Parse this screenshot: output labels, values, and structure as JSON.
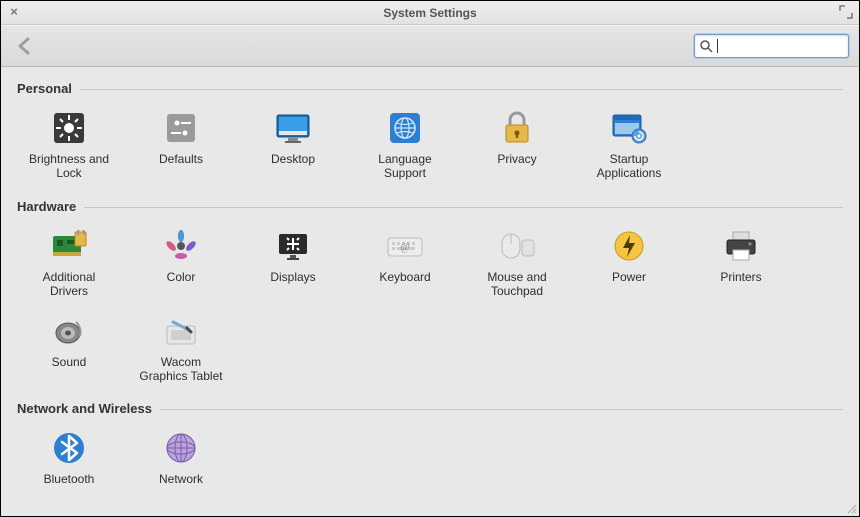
{
  "window": {
    "title": "System Settings"
  },
  "search": {
    "value": ""
  },
  "sections": {
    "personal": {
      "title": "Personal",
      "items": [
        {
          "icon": "brightness",
          "label": "Brightness and\nLock"
        },
        {
          "icon": "defaults",
          "label": "Defaults"
        },
        {
          "icon": "desktop",
          "label": "Desktop"
        },
        {
          "icon": "language",
          "label": "Language\nSupport"
        },
        {
          "icon": "privacy",
          "label": "Privacy"
        },
        {
          "icon": "startup",
          "label": "Startup\nApplications"
        }
      ]
    },
    "hardware": {
      "title": "Hardware",
      "items": [
        {
          "icon": "drivers",
          "label": "Additional\nDrivers"
        },
        {
          "icon": "color",
          "label": "Color"
        },
        {
          "icon": "displays",
          "label": "Displays"
        },
        {
          "icon": "keyboard",
          "label": "Keyboard"
        },
        {
          "icon": "mouse",
          "label": "Mouse and\nTouchpad"
        },
        {
          "icon": "power",
          "label": "Power"
        },
        {
          "icon": "printers",
          "label": "Printers"
        },
        {
          "icon": "sound",
          "label": "Sound"
        },
        {
          "icon": "wacom",
          "label": "Wacom\nGraphics Tablet"
        }
      ]
    },
    "network": {
      "title": "Network and Wireless",
      "items": [
        {
          "icon": "bluetooth",
          "label": "Bluetooth"
        },
        {
          "icon": "network",
          "label": "Network"
        }
      ]
    }
  }
}
